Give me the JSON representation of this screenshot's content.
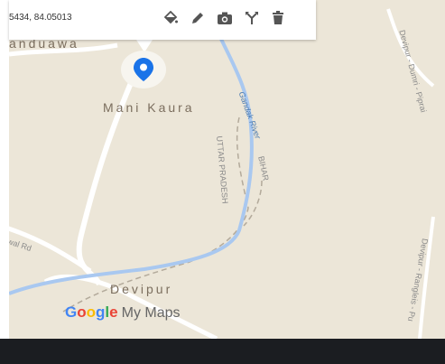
{
  "toolbar": {
    "coordinates": "5434, 84.05013",
    "tools": [
      {
        "name": "paint-bucket-icon",
        "glyph": "🪣"
      },
      {
        "name": "pencil-icon",
        "glyph": "✎"
      },
      {
        "name": "camera-icon",
        "glyph": "📷"
      },
      {
        "name": "directions-icon",
        "glyph": "Y"
      },
      {
        "name": "trash-icon",
        "glyph": "🗑"
      }
    ]
  },
  "map": {
    "places": {
      "top_left": "anduawa",
      "mani_kaura": "Mani Kaura",
      "devipur": "Devipur"
    },
    "roads": {
      "wal_rd": "wal Rd",
      "devipur_dumri": "Devipur - Dumri - Piprai",
      "devipur_rangleis": "Devipur - Rangleis - Pu",
      "uttar_pradesh": "UTTAR PRADESH",
      "bihar": "BIHAR"
    },
    "river": "Gandak River",
    "colors": {
      "land": "#ece6d8",
      "river": "#a9c8f0",
      "road": "#ffffff",
      "pin": "#1a73e8"
    }
  },
  "branding": {
    "google": [
      "G",
      "o",
      "o",
      "g",
      "l",
      "e"
    ],
    "my_maps": "My Maps"
  }
}
